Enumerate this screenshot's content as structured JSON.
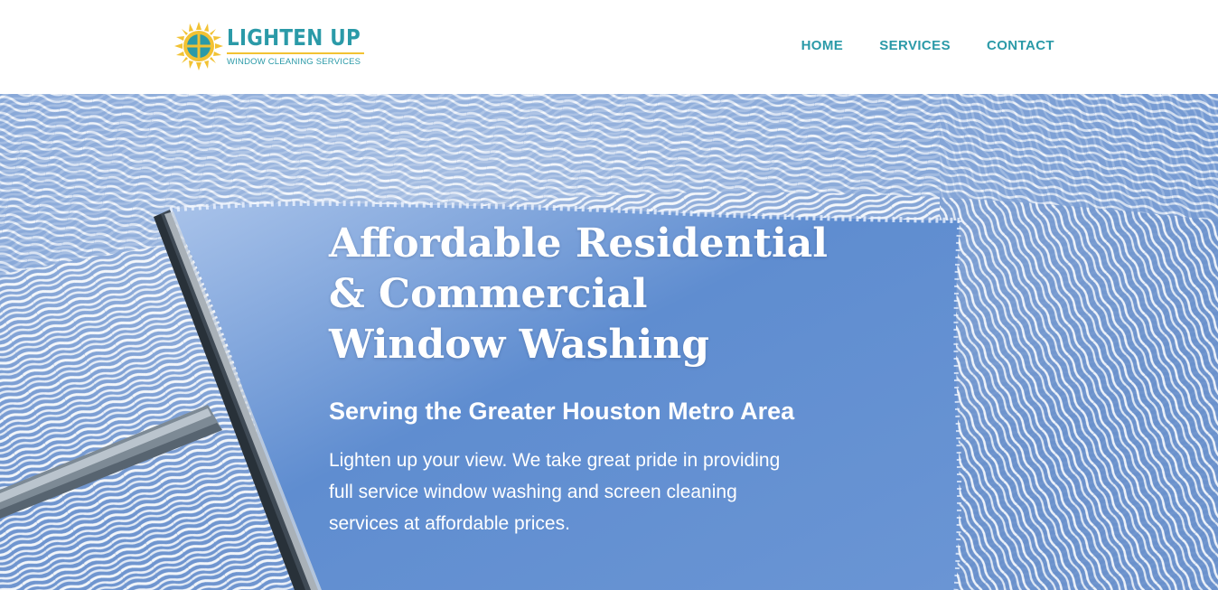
{
  "header": {
    "logo": {
      "title": "LIGHTEN UP",
      "subtitle": "WINDOW CLEANING SERVICES",
      "icon": "sun-window-icon"
    },
    "nav": [
      {
        "label": "HOME"
      },
      {
        "label": "SERVICES"
      },
      {
        "label": "CONTACT"
      }
    ]
  },
  "hero": {
    "title": "Affordable Residential & Commercial Window Washing",
    "subtitle": "Serving the Greater Houston Metro Area",
    "text": "Lighten up your view. We take great pride in providing full service window washing and screen cleaning services at affordable prices.",
    "image": "squeegee-cleaning-soapy-window"
  },
  "colors": {
    "brand_teal": "#2b9aa8",
    "brand_yellow": "#f2c233",
    "sky_blue": "#5b84c4"
  }
}
